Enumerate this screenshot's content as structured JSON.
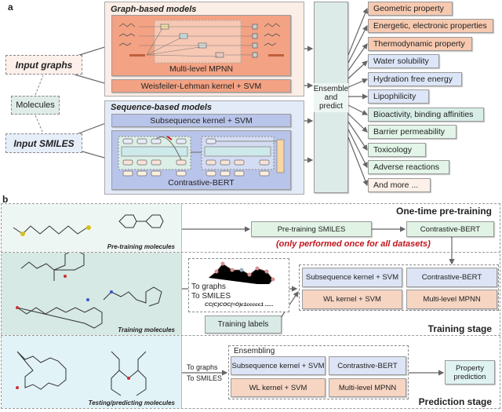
{
  "panel_a": {
    "label": "a",
    "graph_models": {
      "title": "Graph-based models",
      "mpnn": "Multi-level MPNN",
      "wl": "Weisfeiler-Lehman kernel + SVM"
    },
    "sequence_models": {
      "title": "Sequence-based models",
      "subseq": "Subsequence kernel + SVM",
      "bert": "Contrastive-BERT"
    },
    "inputs": {
      "graphs": "Input graphs",
      "molecules": "Molecules",
      "smiles": "Input SMILES"
    },
    "ensemble": "Ensemble and predict",
    "properties": [
      {
        "label": "Geometric property",
        "color": "#f6c9b0"
      },
      {
        "label": "Energetic, electronic properties",
        "color": "#f6c9b0"
      },
      {
        "label": "Thermodynamic property",
        "color": "#f6c9b0"
      },
      {
        "label": "Water solubility",
        "color": "#dde6f8"
      },
      {
        "label": "Hydration free energy",
        "color": "#dde6f8"
      },
      {
        "label": "Lipophilicity",
        "color": "#dde6f8"
      },
      {
        "label": "Bioactivity, binding affinities",
        "color": "#d8ede7"
      },
      {
        "label": "Barrier permeability",
        "color": "#e2f5e8"
      },
      {
        "label": "Toxicology",
        "color": "#e2f5e8"
      },
      {
        "label": "Adverse reactions",
        "color": "#e2f5e8"
      },
      {
        "label": "And more ...",
        "color": "#fdf0e8"
      }
    ]
  },
  "panel_b": {
    "label": "b",
    "pretraining": {
      "stage": "One-time pre-training",
      "molecules": "Pre-training molecules",
      "smiles_box": "Pre-training SMILES",
      "bert": "Contrastive-BERT",
      "note": "(only performed once for all datasets)",
      "note_color": "#c0141c"
    },
    "training": {
      "stage": "Training stage",
      "molecules": "Training molecules",
      "to_graphs": "To graphs",
      "to_smiles": "To SMILES",
      "smiles_example": "CC(C)COC(=O)c1ccccc1 ......",
      "labels": "Training labels",
      "subseq": "Subsequence kernel + SVM",
      "bert": "Contrastive-BERT",
      "wl": "WL kernel + SVM",
      "mpnn": "Multi-level MPNN"
    },
    "prediction": {
      "stage": "Prediction stage",
      "molecules": "Testing/predicting molecules",
      "to_graphs": "To graphs",
      "to_smiles": "To SMILES",
      "ensembling": "Ensembling",
      "subseq": "Subsequence kernel + SVM",
      "bert": "Contrastive-BERT",
      "wl": "WL kernel + SVM",
      "mpnn": "Multi-level MPNN",
      "output": "Property prediction"
    }
  }
}
